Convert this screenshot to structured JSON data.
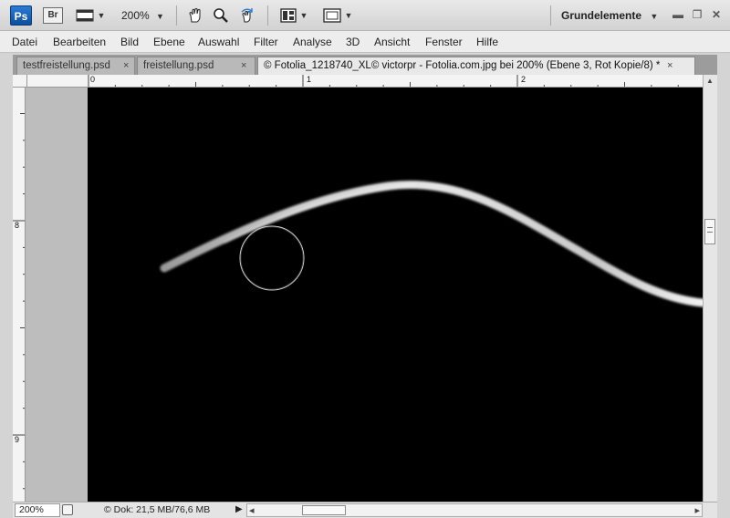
{
  "app": {
    "logo": "Ps",
    "bridge": "Br",
    "zoom": "200%",
    "workspace": "Grundelemente",
    "icons": [
      "hand-tool-icon",
      "zoom-tool-icon",
      "rotate-view-icon",
      "arrange-documents-icon",
      "screen-mode-icon"
    ]
  },
  "menu": [
    "Datei",
    "Bearbeiten",
    "Bild",
    "Ebene",
    "Auswahl",
    "Filter",
    "Analyse",
    "3D",
    "Ansicht",
    "Fenster",
    "Hilfe"
  ],
  "tabs": [
    {
      "label": "testfreistellung.psd",
      "close": "×"
    },
    {
      "label": "freistellung.psd",
      "close": "×"
    },
    {
      "label": "© Fotolia_1218740_XL© victorpr - Fotolia.com.jpg bei 200% (Ebene 3, Rot Kopie/8) *",
      "close": "×"
    }
  ],
  "ruler": {
    "h_labels": [
      "0",
      "1",
      "2"
    ],
    "v_labels": [
      "8",
      "9"
    ]
  },
  "status": {
    "zoom": "200%",
    "doc": "© Dok: 21,5 MB/76,6 MB",
    "play": "▶",
    "left_arrow": "◂",
    "right_arrow": "▸"
  },
  "colors": {
    "canvas": "#000000",
    "accent": "#0b4f9c"
  }
}
